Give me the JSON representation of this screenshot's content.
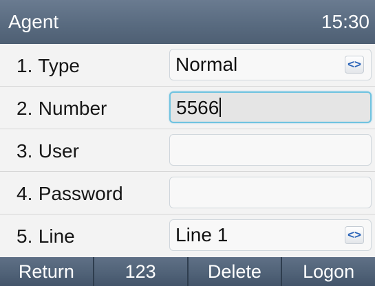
{
  "header": {
    "title": "Agent",
    "time": "15:30"
  },
  "rows": [
    {
      "number": "1.",
      "label": "Type",
      "value": "Normal",
      "has_selector": true,
      "focused": false
    },
    {
      "number": "2.",
      "label": "Number",
      "value": "5566",
      "has_selector": false,
      "focused": true
    },
    {
      "number": "3.",
      "label": "User",
      "value": "",
      "has_selector": false,
      "focused": false
    },
    {
      "number": "4.",
      "label": "Password",
      "value": "",
      "has_selector": false,
      "focused": false
    },
    {
      "number": "5.",
      "label": "Line",
      "value": "Line 1",
      "has_selector": true,
      "focused": false
    }
  ],
  "selector_glyph": "<>",
  "softkeys": {
    "return": "Return",
    "input_mode": "123",
    "delete": "Delete",
    "logon": "Logon"
  },
  "colors": {
    "header": "#596b80",
    "softkey_bar": "#4f6176",
    "focus_border": "#6fc3e0",
    "selector_arrow": "#2a64b8"
  }
}
